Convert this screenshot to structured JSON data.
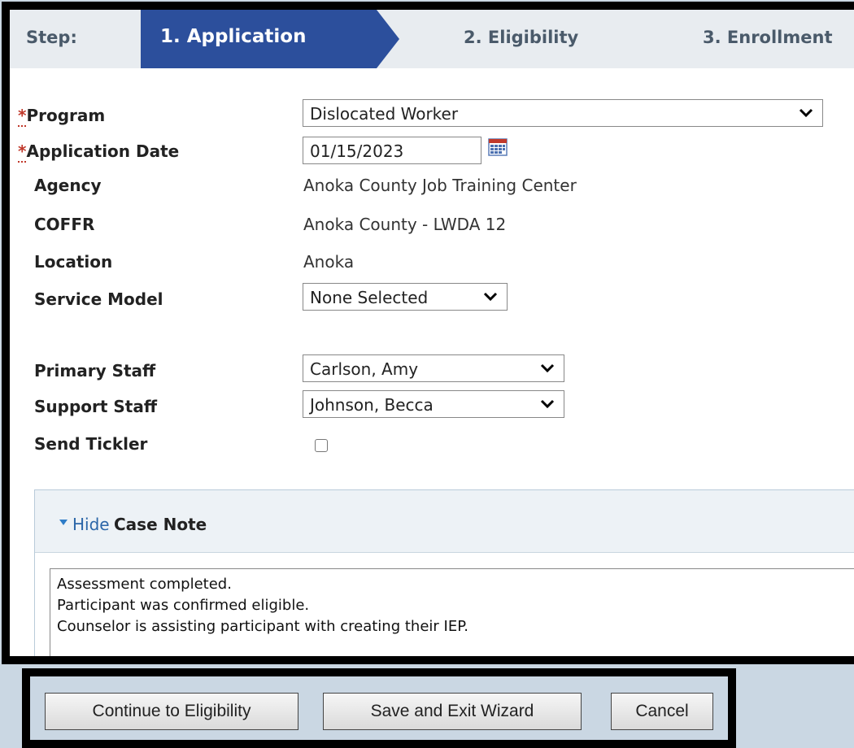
{
  "steps": {
    "label": "Step:",
    "active": "1. Application",
    "eligibility": "2. Eligibility",
    "enrollment": "3. Enrollment"
  },
  "form": {
    "required_marker": "*",
    "program_label": "Program",
    "program_value": "Dislocated Worker",
    "app_date_label": "Application Date",
    "app_date_value": "01/15/2023",
    "agency_label": "Agency",
    "agency_value": "Anoka County Job Training Center",
    "coffr_label": "COFFR",
    "coffr_value": "Anoka County - LWDA 12",
    "location_label": "Location",
    "location_value": "Anoka",
    "service_model_label": "Service Model",
    "service_model_value": "None Selected",
    "primary_staff_label": "Primary Staff",
    "primary_staff_value": "Carlson, Amy",
    "support_staff_label": "Support Staff",
    "support_staff_value": "Johnson, Becca",
    "send_tickler_label": "Send Tickler",
    "send_tickler_checked": false
  },
  "case_note": {
    "toggle_label": "Hide",
    "title": "Case Note",
    "lines": [
      "Assessment completed.",
      "Participant was confirmed eligible.",
      "Counselor is assisting participant with creating their IEP."
    ]
  },
  "buttons": {
    "continue": "Continue to Eligibility",
    "save_exit": "Save and Exit Wizard",
    "cancel": "Cancel"
  },
  "colors": {
    "active_step": "#2c4f9c",
    "required": "#c0392b",
    "link": "#2b66a8"
  }
}
